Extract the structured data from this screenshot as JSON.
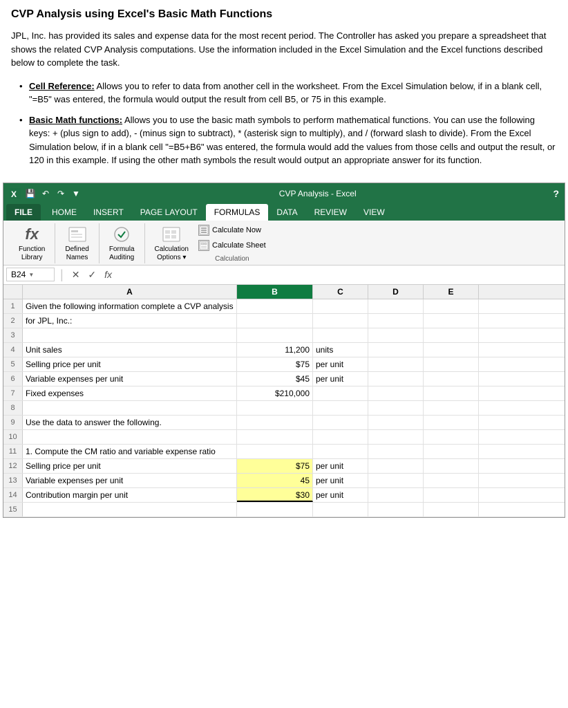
{
  "page": {
    "title": "CVP Analysis using Excel's Basic Math Functions",
    "intro": "JPL, Inc. has provided its sales and expense data for the most recent period.  The Controller has asked you prepare a spreadsheet that shows the related CVP Analysis computations.  Use the information included in the Excel Simulation and the Excel functions described below to complete the task.",
    "bullets": [
      {
        "term": "Cell Reference:",
        "text": "  Allows you to refer to data from another cell in the worksheet.  From the Excel Simulation below, if in a blank cell, \"=B5\" was entered, the formula would output the result from cell B5, or 75 in this example."
      },
      {
        "term": "Basic Math functions:",
        "text": "  Allows you to use the basic math symbols to perform mathematical functions.  You can use the following keys:  + (plus sign to add), - (minus sign to subtract), * (asterisk sign to multiply), and / (forward slash to divide).  From the Excel Simulation below, if in a blank cell \"=B5+B6\" was entered, the formula would add the values from those cells and output the result, or 120 in this example.  If using the other math symbols the result would output an appropriate answer for its function."
      }
    ]
  },
  "excel": {
    "window_title": "CVP Analysis - Excel",
    "question_mark": "?",
    "title_bar_icons": [
      "xl-icon",
      "save-icon",
      "undo-icon",
      "redo-icon",
      "quick-icon"
    ],
    "tabs": [
      {
        "label": "FILE",
        "active": false,
        "file": true
      },
      {
        "label": "HOME",
        "active": false
      },
      {
        "label": "INSERT",
        "active": false
      },
      {
        "label": "PAGE LAYOUT",
        "active": false
      },
      {
        "label": "FORMULAS",
        "active": true
      },
      {
        "label": "DATA",
        "active": false
      },
      {
        "label": "REVIEW",
        "active": false
      },
      {
        "label": "VIEW",
        "active": false
      }
    ],
    "ribbon": {
      "groups": [
        {
          "name": "Function Library",
          "buttons": [
            {
              "icon": "fx",
              "label": "Function\nLibrary"
            }
          ]
        },
        {
          "name": "",
          "buttons": [
            {
              "icon": "📋",
              "label": "Defined\nNames"
            },
            {
              "icon": "✔",
              "label": "Formula\nAuditing"
            }
          ]
        },
        {
          "name": "Calculation",
          "label": "Calculation\nOptions",
          "calc_buttons": [
            {
              "label": "Calculate Now"
            },
            {
              "label": "Calculate Sheet"
            }
          ]
        }
      ]
    },
    "formula_bar": {
      "cell_ref": "B24",
      "fx": "fx"
    },
    "columns": [
      "A",
      "B",
      "C",
      "D",
      "E"
    ],
    "rows": [
      {
        "num": 1,
        "a": "Given the following information complete a CVP analysis",
        "b": "",
        "c": "",
        "d": "",
        "e": ""
      },
      {
        "num": 2,
        "a": "for JPL, Inc.:",
        "b": "",
        "c": "",
        "d": "",
        "e": ""
      },
      {
        "num": 3,
        "a": "",
        "b": "",
        "c": "",
        "d": "",
        "e": ""
      },
      {
        "num": 4,
        "a": "Unit sales",
        "b": "11,200",
        "c": "units",
        "d": "",
        "e": ""
      },
      {
        "num": 5,
        "a": "Selling price per unit",
        "b": "$75",
        "c": "per unit",
        "d": "",
        "e": ""
      },
      {
        "num": 6,
        "a": "Variable expenses per unit",
        "b": "$45",
        "c": "per unit",
        "d": "",
        "e": ""
      },
      {
        "num": 7,
        "a": "Fixed expenses",
        "b": "$210,000",
        "c": "",
        "d": "",
        "e": ""
      },
      {
        "num": 8,
        "a": "",
        "b": "",
        "c": "",
        "d": "",
        "e": ""
      },
      {
        "num": 9,
        "a": "Use the data to answer the following.",
        "b": "",
        "c": "",
        "d": "",
        "e": ""
      },
      {
        "num": 10,
        "a": "",
        "b": "",
        "c": "",
        "d": "",
        "e": ""
      },
      {
        "num": 11,
        "a": "1. Compute the CM ratio and variable expense ratio",
        "b": "",
        "c": "",
        "d": "",
        "e": ""
      },
      {
        "num": 12,
        "a": "Selling price per unit",
        "b": "$75",
        "c": "per unit",
        "d": "",
        "e": "",
        "b_highlight": true
      },
      {
        "num": 13,
        "a": "Variable expenses per unit",
        "b": "45",
        "c": "per unit",
        "d": "",
        "e": "",
        "b_highlight": true
      },
      {
        "num": 14,
        "a": "Contribution margin per unit",
        "b": "$30",
        "c": "per unit",
        "d": "",
        "e": "",
        "b_highlight": true,
        "b_bold_bottom": true
      },
      {
        "num": 15,
        "a": "",
        "b": "",
        "c": "",
        "d": "",
        "e": ""
      }
    ]
  }
}
